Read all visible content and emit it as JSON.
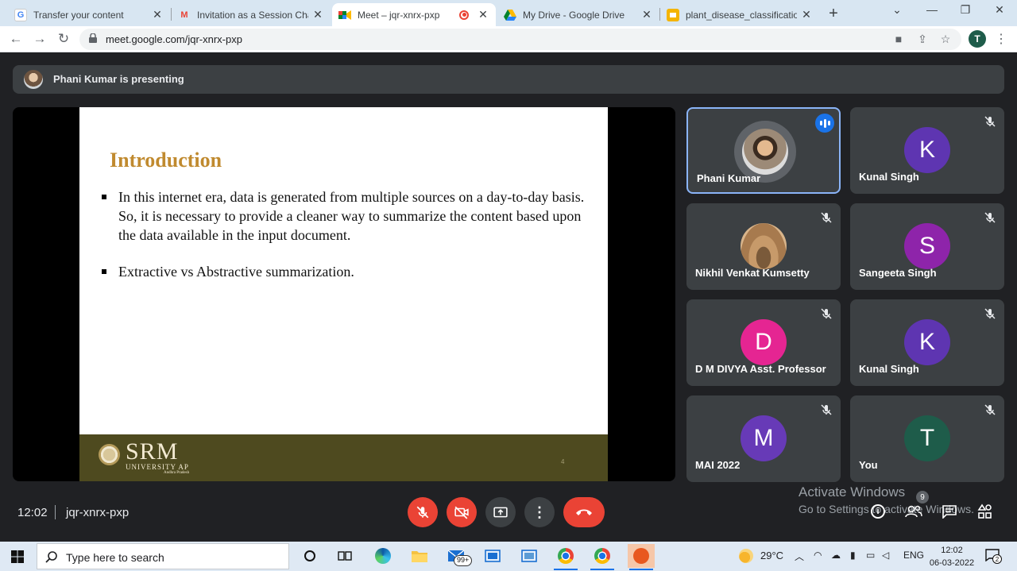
{
  "browser": {
    "tabs": [
      {
        "title": "Transfer your content",
        "icon": "google-g-icon"
      },
      {
        "title": "Invitation as a Session Chair/",
        "icon": "gmail-icon"
      },
      {
        "title": "Meet – jqr-xnrx-pxp",
        "icon": "meet-icon",
        "active": true
      },
      {
        "title": "My Drive - Google Drive",
        "icon": "drive-icon"
      },
      {
        "title": "plant_disease_classification_",
        "icon": "slides-icon"
      }
    ],
    "url": "meet.google.com/jqr-xnrx-pxp",
    "profile_initial": "T"
  },
  "meet": {
    "presenting_banner": "Phani Kumar is presenting",
    "slide": {
      "title": "Introduction",
      "bullets": [
        "In this internet era, data is generated from multiple sources on a day-to-day basis. So, it is necessary to provide a cleaner way to summarize the content based upon the data available in the input document.",
        "Extractive vs Abstractive summarization."
      ],
      "footer_logo": "SRM",
      "footer_logo_sub": "UNIVERSITY AP",
      "footer_logo_sub2": "Andhra Pradesh",
      "page_number": "4"
    },
    "participants": [
      {
        "name": "Phani Kumar",
        "type": "photo",
        "speaking": true
      },
      {
        "name": "Kunal Singh",
        "initial": "K",
        "color": "#5e35b1",
        "muted": true
      },
      {
        "name": "Nikhil Venkat Kumsetty",
        "type": "photo",
        "muted": true
      },
      {
        "name": "Sangeeta Singh",
        "initial": "S",
        "color": "#8e24aa",
        "muted": true
      },
      {
        "name": "D M DIVYA Asst. Professor",
        "initial": "D",
        "color": "#e52592",
        "muted": true
      },
      {
        "name": "Kunal Singh",
        "initial": "K",
        "color": "#5e35b1",
        "muted": true
      },
      {
        "name": "MAI 2022",
        "initial": "M",
        "color": "#673ab7",
        "muted": true
      },
      {
        "name": "You",
        "initial": "T",
        "color": "#1e5c4a",
        "muted": true
      }
    ],
    "bottom": {
      "time": "12:02",
      "meeting_code": "jqr-xnrx-pxp",
      "people_count": "9"
    },
    "activate_windows": {
      "line1": "Activate Windows",
      "line2": "Go to Settings to activate Windows."
    }
  },
  "taskbar": {
    "search_placeholder": "Type here to search",
    "mail_badge": "99+",
    "weather": "29°C",
    "language": "ENG",
    "time": "12:02",
    "date": "06-03-2022",
    "notification_count": "2"
  }
}
